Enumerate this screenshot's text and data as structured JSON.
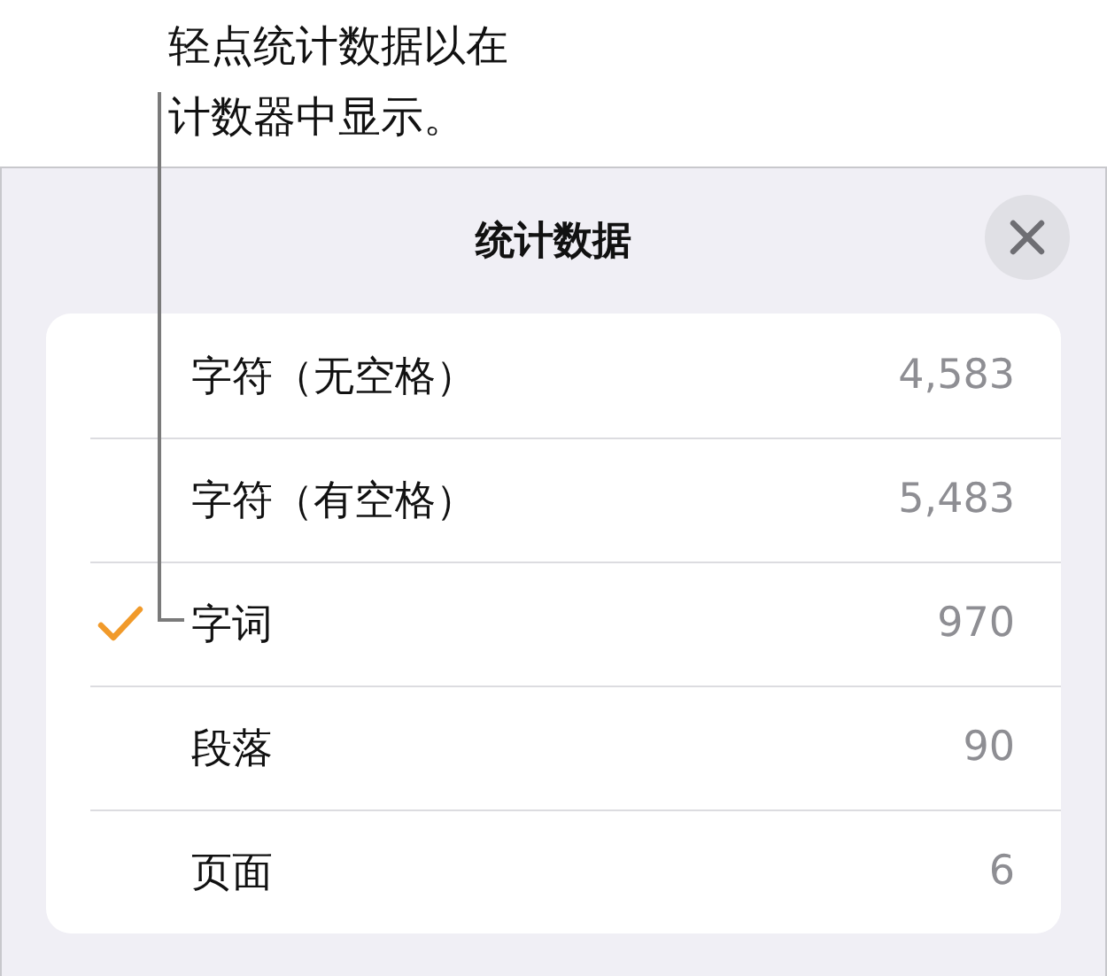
{
  "callout": "轻点统计数据以在计数器中显示。",
  "panel": {
    "title": "统计数据",
    "rows": [
      {
        "label": "字符（无空格）",
        "value": "4,583",
        "selected": false
      },
      {
        "label": "字符（有空格）",
        "value": "5,483",
        "selected": false
      },
      {
        "label": "字词",
        "value": "970",
        "selected": true
      },
      {
        "label": "段落",
        "value": "90",
        "selected": false
      },
      {
        "label": "页面",
        "value": "6",
        "selected": false
      }
    ]
  }
}
